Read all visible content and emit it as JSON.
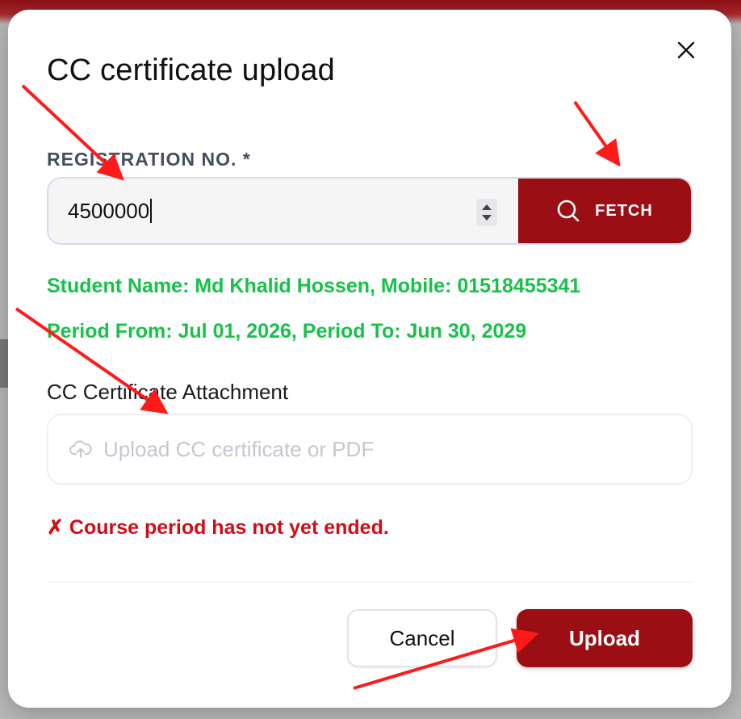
{
  "modal": {
    "title": "CC certificate upload",
    "registration": {
      "label": "REGISTRATION NO. *",
      "value": "4500000",
      "fetch_label": "FETCH"
    },
    "student_info": {
      "line1": "Student Name: Md Khalid Hossen, Mobile: 01518455341",
      "line2": "Period From: Jul 01, 2026, Period To: Jun 30, 2029"
    },
    "attachment": {
      "label": "CC Certificate Attachment",
      "placeholder": "Upload CC certificate or PDF"
    },
    "error": "✗ Course period has not yet ended.",
    "footer": {
      "cancel_label": "Cancel",
      "upload_label": "Upload"
    }
  },
  "icons": {
    "close": "close-icon",
    "search": "search-icon",
    "upload": "cloud-upload-icon"
  },
  "colors": {
    "primary": "#9a0e14",
    "success": "#17c14a",
    "error": "#d30c16",
    "annotation": "#ff1a1a"
  }
}
